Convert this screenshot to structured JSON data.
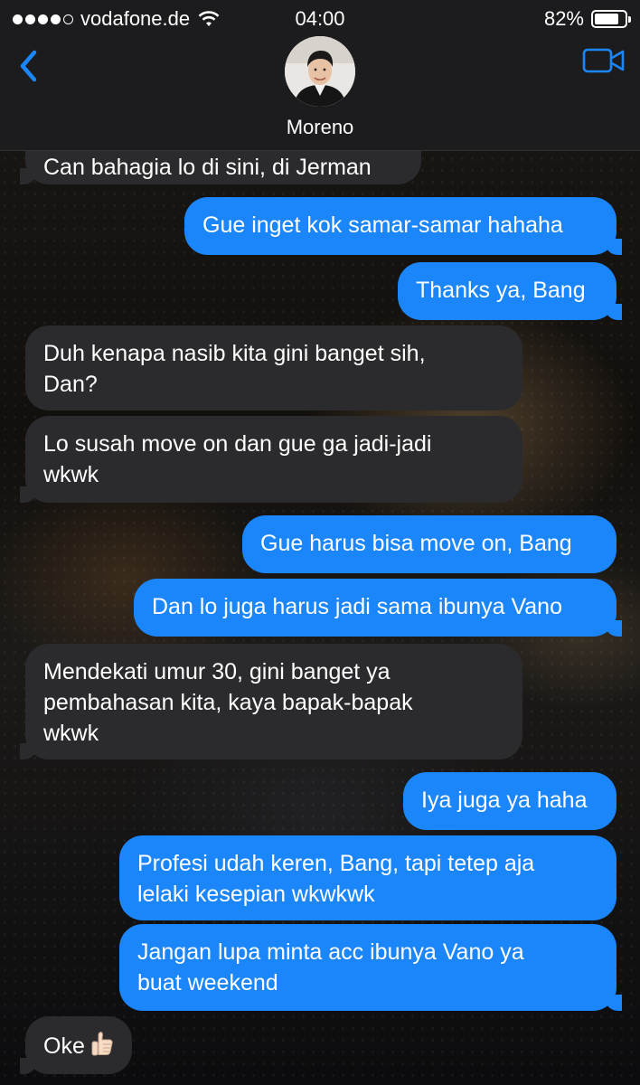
{
  "status_bar": {
    "carrier": "vodafone.de",
    "time": "04:00",
    "battery_percent": "82%",
    "battery_level": 0.82,
    "signal_bars_filled": 4,
    "signal_bars_total": 5
  },
  "header": {
    "contact_name": "Moreno"
  },
  "colors": {
    "outgoing": "#1b86f9",
    "incoming": "#2b2b2e",
    "accent": "#1b86f9"
  },
  "messages": [
    {
      "from": "in",
      "text": "Can bahagia lo di sini, di Jerman"
    },
    {
      "from": "out",
      "text": "Gue inget kok samar-samar hahaha"
    },
    {
      "from": "out",
      "text": "Thanks ya, Bang"
    },
    {
      "from": "in",
      "lines": [
        "Duh kenapa nasib kita gini banget sih,",
        "Dan?"
      ]
    },
    {
      "from": "in",
      "lines": [
        "Lo susah move on dan gue ga jadi-jadi",
        "wkwk"
      ]
    },
    {
      "from": "out",
      "text": "Gue harus bisa move on, Bang"
    },
    {
      "from": "out",
      "text": "Dan lo juga harus jadi sama ibunya Vano"
    },
    {
      "from": "in",
      "lines": [
        "Mendekati umur 30, gini banget ya",
        "pembahasan kita, kaya bapak-bapak",
        "wkwk"
      ]
    },
    {
      "from": "out",
      "text": "Iya juga ya haha"
    },
    {
      "from": "out",
      "lines": [
        "Profesi udah keren, Bang, tapi tetep aja",
        "lelaki kesepian wkwkwk"
      ]
    },
    {
      "from": "out",
      "lines": [
        "Jangan lupa minta acc ibunya Vano ya",
        "buat weekend"
      ]
    },
    {
      "from": "in",
      "text": "Oke",
      "emoji": "thumbs-up"
    }
  ]
}
